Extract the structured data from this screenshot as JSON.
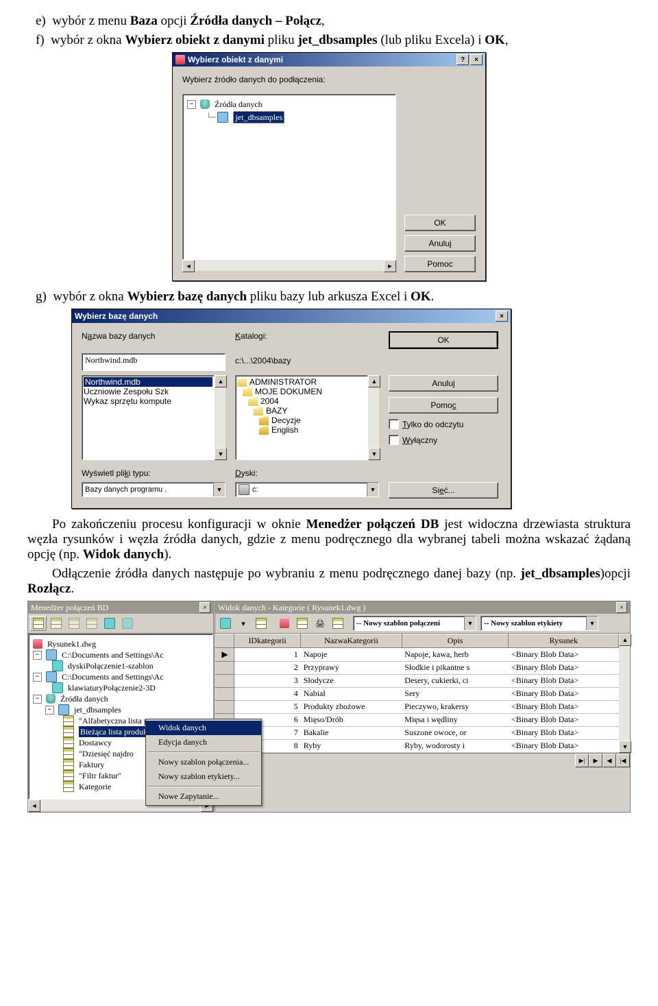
{
  "text": {
    "e_line": "wybór z menu Baza opcji Źródła danych – Połącz,",
    "e_marker": "e)",
    "f_line1": "wybór z okna Wybierz obiekt z danymi pliku jet_dbsamples (lub pliku Excela) i OK,",
    "f_marker": "f)",
    "g_line": "wybór z okna Wybierz bazę danych pliku bazy lub arkusza Excel i OK.",
    "g_marker": "g)",
    "after_p1": "Po zakończeniu procesu konfiguracji w oknie Menedżer połączeń DB jest widoczna drzewiasta struktura węzła rysunków i węzła źródła danych, gdzie z menu podręcznego dla wybranej tabeli można wskazać żądaną opcję (np. Widok danych).",
    "after_p2": "Odłączenie źródła danych następuje po wybraniu z menu podręcznego danej bazy (np. jet_dbsamples)opcji Rozłącz."
  },
  "dlg1": {
    "title": "Wybierz obiekt z danymi",
    "instruction": "Wybierz źródło danych do podłączenia:",
    "tree_root": "Źródła danych",
    "tree_item": "jet_dbsamples",
    "ok": "OK",
    "cancel": "Anuluj",
    "help": "Pomoc"
  },
  "dlg2": {
    "title": "Wybierz bazę danych",
    "lbl_dbname": "Nazwa bazy danych",
    "dbname_value": "Northwind.mdb",
    "lbl_katalogi": "Katalogi:",
    "katalogi_value": "c:\\...\\2004\\bazy",
    "files": [
      "Northwind.mdb",
      "Uczniowie Zespołu Szk",
      "Wykaz sprzętu kompute"
    ],
    "dirs": [
      "ADMINISTRATOR",
      "MOJE DOKUMEN",
      "2004",
      "BAZY",
      "Decyzje",
      "English"
    ],
    "lbl_type": "Wyświetl pliki typu:",
    "type_value": "Bazy danych programu .",
    "lbl_drives": "Dyski:",
    "drive_value": "c:",
    "ok": "OK",
    "cancel": "Anuluj",
    "help": "Pomoc",
    "readonly": "Tylko do odczytu",
    "exclusive": "Wyłączny",
    "network": "Sieć..."
  },
  "mgr": {
    "title": "Menedżer połączeń BD",
    "tree": {
      "rys1": "Rysunek1.dwg",
      "path1": "C:\\Documents and Settings\\Ac",
      "tpl1": "dyskiPołączenie1-szablon",
      "path2": "C:\\Documents and Settings\\Ac",
      "tpl2": "klawiaturyPołączenie2-3D",
      "src_root": "Źródła danych",
      "db": "jet_dbsamples",
      "items": [
        "\"Alfabetyczna lista pro",
        "Bieżąca lista produktó",
        "Dostawcy",
        "\"Dziesięć najdro",
        "Faktury",
        "\"Filtr faktur\"",
        "Kategorie"
      ]
    }
  },
  "dv": {
    "title": "Widok danych - Kategorie ( Rysunek1.dwg )",
    "combo1": "-- Nowy szablon połączeni",
    "combo2": "-- Nowy szablon etykiety",
    "cols": [
      "IDkategorii",
      "NazwaKategorii",
      "Opis",
      "Rysunek"
    ],
    "rows": [
      [
        "1",
        "Napoje",
        "Napoje, kawa, herb",
        "<Binary Blob Data>"
      ],
      [
        "2",
        "Przyprawy",
        "Słodkie i pikantne s",
        "<Binary Blob Data>"
      ],
      [
        "3",
        "Słodycze",
        "Desery, cukierki, ci",
        "<Binary Blob Data>"
      ],
      [
        "4",
        "Nabiał",
        "Sery",
        "<Binary Blob Data>"
      ],
      [
        "5",
        "Produkty zbożowe",
        "Pieczywo, krakersy",
        "<Binary Blob Data>"
      ],
      [
        "6",
        "Mięso/Drób",
        "Mięsa i wędliny",
        "<Binary Blob Data>"
      ],
      [
        "7",
        "Bakalie",
        "Suszone owoce, or",
        "<Binary Blob Data>"
      ],
      [
        "8",
        "Ryby",
        "Ryby, wodorosty i",
        "<Binary Blob Data>"
      ]
    ]
  },
  "ctx": {
    "items": [
      "Widok danych",
      "Edycja danych",
      "Nowy szablon połączenia...",
      "Nowy szablon etykiety...",
      "Nowe Zapytanie..."
    ]
  }
}
